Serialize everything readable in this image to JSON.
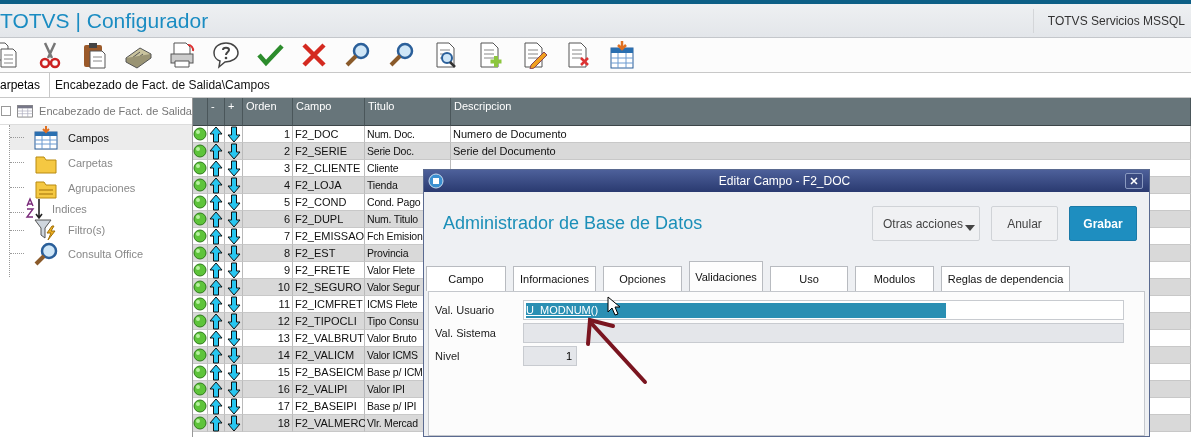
{
  "app": {
    "title": "TOTVS | Configurador",
    "environment": "TOTVS Servicios MSSQL"
  },
  "path_bar": {
    "label": "arpetas",
    "value": "Encabezado de Fact. de Salida\\Campos"
  },
  "tree": {
    "label": "Encabezado de Fact. de Salida",
    "children": [
      {
        "label": "Campos",
        "kind": "table",
        "selected": true
      },
      {
        "label": "Carpetas",
        "kind": "folder",
        "selected": false
      },
      {
        "label": "Agrupaciones",
        "kind": "group",
        "selected": false
      },
      {
        "label": "Indices",
        "kind": "sort",
        "selected": false
      },
      {
        "label": "Filtro(s)",
        "kind": "filter",
        "selected": false
      },
      {
        "label": "Consulta Office",
        "kind": "search",
        "selected": false
      }
    ]
  },
  "grid": {
    "columns": [
      "-",
      "+",
      "Orden",
      "Campo",
      "Titulo",
      "Descripcion"
    ],
    "rows": [
      {
        "orden": "1",
        "campo": "F2_DOC",
        "titulo": "Num. Doc.",
        "descripcion": "Numero de Documento"
      },
      {
        "orden": "2",
        "campo": "F2_SERIE",
        "titulo": "Serie Doc.",
        "descripcion": "Serie del Documento"
      },
      {
        "orden": "3",
        "campo": "F2_CLIENTE",
        "titulo": "Cliente"
      },
      {
        "orden": "4",
        "campo": "F2_LOJA",
        "titulo": "Tienda"
      },
      {
        "orden": "5",
        "campo": "F2_COND",
        "titulo": "Cond. Pago"
      },
      {
        "orden": "6",
        "campo": "F2_DUPL",
        "titulo": "Num. Titulo"
      },
      {
        "orden": "7",
        "campo": "F2_EMISSAO",
        "titulo": "Fch Emision"
      },
      {
        "orden": "8",
        "campo": "F2_EST",
        "titulo": "Provincia"
      },
      {
        "orden": "9",
        "campo": "F2_FRETE",
        "titulo": "Valor Flete"
      },
      {
        "orden": "10",
        "campo": "F2_SEGURO",
        "titulo": "Valor Segur"
      },
      {
        "orden": "11",
        "campo": "F2_ICMFRET",
        "titulo": "ICMS Flete"
      },
      {
        "orden": "12",
        "campo": "F2_TIPOCLI",
        "titulo": "Tipo Consu"
      },
      {
        "orden": "13",
        "campo": "F2_VALBRUT",
        "titulo": "Valor Bruto"
      },
      {
        "orden": "14",
        "campo": "F2_VALICM",
        "titulo": "Valor ICMS"
      },
      {
        "orden": "15",
        "campo": "F2_BASEICM",
        "titulo": "Base p/ ICM"
      },
      {
        "orden": "16",
        "campo": "F2_VALIPI",
        "titulo": "Valor IPI"
      },
      {
        "orden": "17",
        "campo": "F2_BASEIPI",
        "titulo": "Base p/ IPI"
      },
      {
        "orden": "18",
        "campo": "F2_VALMERC",
        "titulo": "Vlr. Mercad"
      }
    ]
  },
  "dialog": {
    "title": "Editar Campo - F2_DOC",
    "heading": "Administrador de Base de Datos",
    "buttons": [
      {
        "label": "Otras acciones",
        "kind": "menu"
      },
      {
        "label": "Anular",
        "kind": "secondary"
      },
      {
        "label": "Grabar",
        "kind": "primary"
      }
    ],
    "tabs": [
      {
        "label": "Campo",
        "selected": false
      },
      {
        "label": "Informaciones",
        "selected": false
      },
      {
        "label": "Opciones",
        "selected": false
      },
      {
        "label": "Validaciones",
        "selected": true
      },
      {
        "label": "Uso",
        "selected": false
      },
      {
        "label": "Modulos",
        "selected": false
      },
      {
        "label": "Reglas de dependencia",
        "selected": false
      }
    ],
    "fields": [
      {
        "label": "Val. Usuario",
        "value": "U_MODNUM()",
        "kind": "text",
        "text_selected": true,
        "disabled": false
      },
      {
        "label": "Val. Sistema",
        "kind": "text",
        "disabled": true
      },
      {
        "label": "Nivel",
        "value": "1",
        "kind": "number",
        "text_selected": false,
        "disabled": true
      }
    ]
  }
}
